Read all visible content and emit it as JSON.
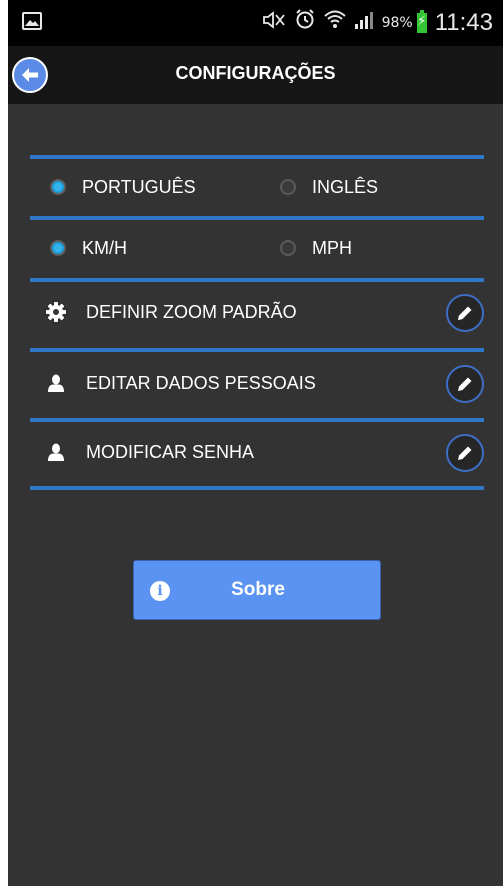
{
  "status_bar": {
    "battery_percent": "98%",
    "time": "11:43",
    "icons": [
      "gallery-icon",
      "muted-icon",
      "alarm-icon",
      "wifi-icon",
      "signal-icon",
      "battery-charging-icon"
    ]
  },
  "header": {
    "title": "CONFIGURAÇÕES",
    "back_icon": "arrow-left-icon"
  },
  "settings": {
    "language": {
      "options": [
        {
          "label": "PORTUGUÊS",
          "selected": true
        },
        {
          "label": "INGLÊS",
          "selected": false
        }
      ]
    },
    "speed_unit": {
      "options": [
        {
          "label": "KM/H",
          "selected": true
        },
        {
          "label": "MPH",
          "selected": false
        }
      ]
    },
    "items": [
      {
        "label": "DEFINIR ZOOM PADRÃO",
        "icon": "gear-icon",
        "action_icon": "pencil-icon"
      },
      {
        "label": "EDITAR DADOS PESSOAIS",
        "icon": "user-icon",
        "action_icon": "pencil-icon"
      },
      {
        "label": "MODIFICAR SENHA",
        "icon": "user-icon",
        "action_icon": "pencil-icon"
      }
    ]
  },
  "about_button": {
    "label": "Sobre",
    "icon": "info-icon",
    "icon_glyph": "i"
  },
  "colors": {
    "background": "#333333",
    "accent_divider": "#2f77c8",
    "button_blue": "#5b93f2",
    "radio_selected": "#1ea0da"
  }
}
